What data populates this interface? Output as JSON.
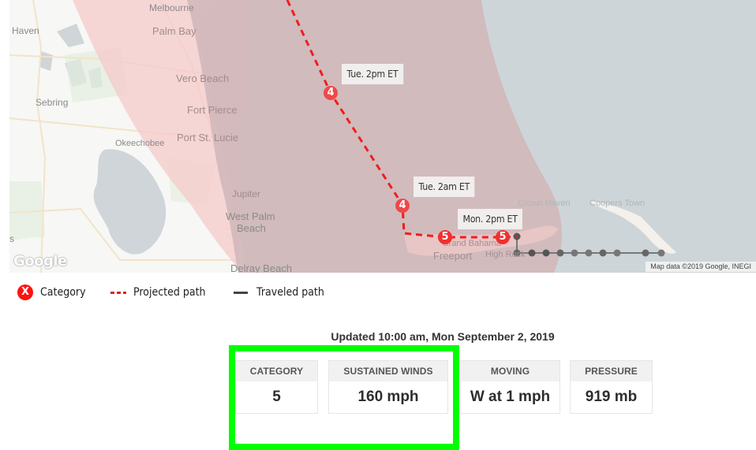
{
  "map": {
    "places": {
      "melbourne": "Melbourne",
      "haven": "Haven",
      "palm_bay": "Palm Bay",
      "vero_beach": "Vero Beach",
      "sebring": "Sebring",
      "fort_pierce": "Fort Pierce",
      "port_st_lucie": "Port St. Lucie",
      "okeechobee": "Okeechobee",
      "jupiter": "Jupiter",
      "west_palm_beach_1": "West Palm",
      "west_palm_beach_2": "Beach",
      "delray_beach": "Delray Beach",
      "partial_s": "s",
      "grand_bahama": "Grand Bahama",
      "freeport": "Freeport",
      "high_rock": "High Rock",
      "crown_haven": "Crown Haven",
      "coopers_town": "Coopers Town"
    },
    "time_labels": {
      "tue_2pm": "Tue. 2pm ET",
      "tue_2am": "Tue. 2am ET",
      "mon_2pm": "Mon. 2pm ET"
    },
    "markers": [
      {
        "category": "4",
        "time": "Tue. 2pm ET"
      },
      {
        "category": "4",
        "time": "Tue. 2am ET"
      },
      {
        "category": "5",
        "time": ""
      },
      {
        "category": "5",
        "time": "Mon. 2pm ET"
      }
    ],
    "google_logo": "Google",
    "attribution": "Map data ©2019 Google, INEGI",
    "colors": {
      "cone_outer": "#f6c9c9",
      "cone_inner": "#d4bcbf",
      "sea": "#cdd5d8",
      "projected_path": "#f01e1e",
      "traveled_path": "#555555",
      "marker": "#f22f2f"
    }
  },
  "legend": {
    "category_icon": "X",
    "category_label": "Category",
    "projected_label": "Projected path",
    "traveled_label": "Traveled path"
  },
  "updated": "Updated 10:00 am, Mon September 2, 2019",
  "stats": {
    "category": {
      "label": "CATEGORY",
      "value": "5"
    },
    "winds": {
      "label": "SUSTAINED WINDS",
      "value": "160 mph"
    },
    "moving": {
      "label": "MOVING",
      "value": "W at 1 mph"
    },
    "pressure": {
      "label": "PRESSURE",
      "value": "919 mb"
    }
  }
}
